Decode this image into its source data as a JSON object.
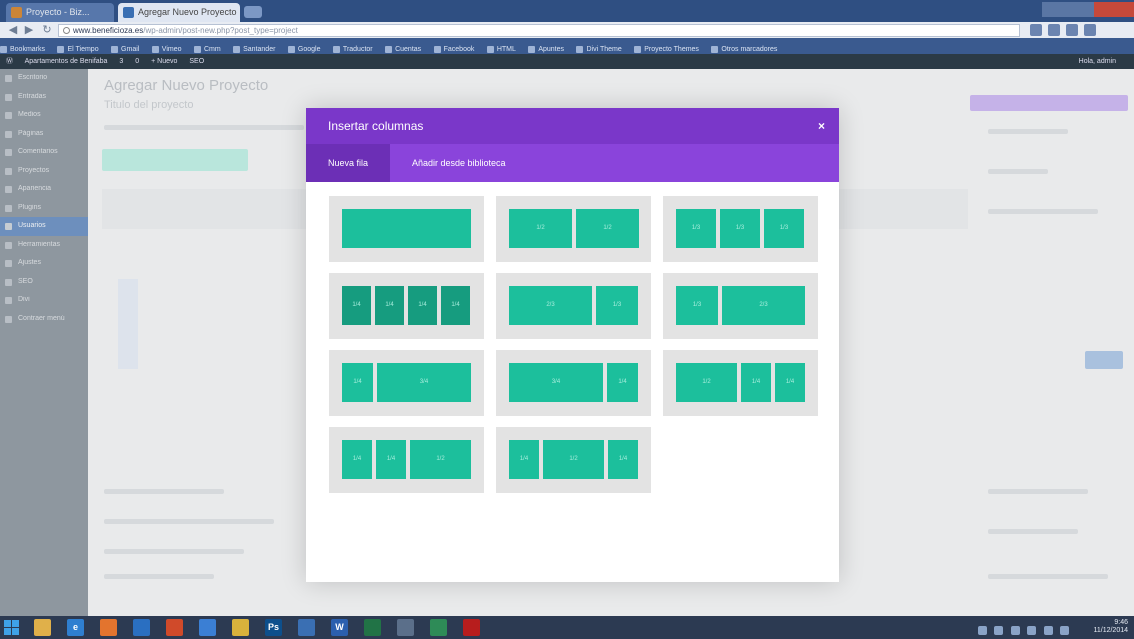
{
  "browser": {
    "tabs": [
      {
        "label": "Proyecto - Biz..."
      },
      {
        "label": "Agregar Nuevo Proyecto"
      }
    ],
    "url_host": "www.beneficioza.es",
    "url_path": "/wp-admin/post-new.php?post_type=project",
    "bookmarks": [
      "Bookmarks",
      "El Tiempo",
      "Gmail",
      "Vimeo",
      "Cmm",
      "Santander",
      "Google",
      "Traductor",
      "Cuentas",
      "Facebook",
      "HTML",
      "Apuntes",
      "Divi Theme",
      "Proyecto Themes",
      "Otros marcadores"
    ],
    "wp_bar": {
      "site": "Apartamentos de Benifaba",
      "comments": "3",
      "updates": "0",
      "new": "+ Nuevo",
      "seo": "SEO",
      "right": "Hola, admin"
    }
  },
  "wp": {
    "page_heading": "Agregar Nuevo Proyecto",
    "post_title": "Titulo del proyecto",
    "menu_items": [
      "Escritorio",
      "Entradas",
      "Medios",
      "Páginas",
      "Comentarios",
      "Proyectos",
      "Apariencia",
      "Plugins",
      "Usuarios",
      "Herramientas",
      "Ajustes",
      "SEO",
      "Divi",
      "Contraer menú"
    ],
    "active_menu_index": 5
  },
  "modal": {
    "title": "Insertar columnas",
    "close_icon": "×",
    "tabs": [
      {
        "label": "Nueva fila",
        "active": true
      },
      {
        "label": "Añadir desde biblioteca",
        "active": false
      }
    ],
    "layouts": [
      {
        "name": "1 columna",
        "columns": [
          ""
        ]
      },
      {
        "name": "1/2 + 1/2",
        "columns": [
          "1/2",
          "1/2"
        ]
      },
      {
        "name": "1/3 + 1/3 + 1/3",
        "columns": [
          "1/3",
          "1/3",
          "1/3"
        ]
      },
      {
        "name": "1/4 x4",
        "columns": [
          "1/4",
          "1/4",
          "1/4",
          "1/4"
        ]
      },
      {
        "name": "2/3 + 1/3",
        "columns": [
          "2/3",
          "1/3"
        ]
      },
      {
        "name": "1/3 + 2/3",
        "columns": [
          "1/3",
          "2/3"
        ]
      },
      {
        "name": "1/4 + 3/4",
        "columns": [
          "1/4",
          "3/4"
        ]
      },
      {
        "name": "3/4 + 1/4",
        "columns": [
          "3/4",
          "1/4"
        ]
      },
      {
        "name": "1/2 + 1/4 + 1/4",
        "columns": [
          "1/2",
          "1/4",
          "1/4"
        ]
      },
      {
        "name": "1/4 + 1/4 + 1/2",
        "columns": [
          "1/4",
          "1/4",
          "1/2"
        ]
      },
      {
        "name": "1/4 + 1/2 + 1/4",
        "columns": [
          "1/4",
          "1/2",
          "1/4"
        ]
      }
    ]
  },
  "taskbar": {
    "apps": [
      {
        "icon": "file-explorer-icon",
        "color": "#e0b04a",
        "glyph": ""
      },
      {
        "icon": "internet-explorer-icon",
        "color": "#2f7fd0",
        "glyph": "e"
      },
      {
        "icon": "firefox-icon",
        "color": "#e3742e",
        "glyph": ""
      },
      {
        "icon": "outlook-icon",
        "color": "#2a6fc1",
        "glyph": ""
      },
      {
        "icon": "powerpoint-icon",
        "color": "#d04a2a",
        "glyph": ""
      },
      {
        "icon": "mail-icon",
        "color": "#3b7fd4",
        "glyph": ""
      },
      {
        "icon": "chrome-icon",
        "color": "#d8b23c",
        "glyph": ""
      },
      {
        "icon": "photoshop-icon",
        "color": "#0d4f8c",
        "glyph": "Ps"
      },
      {
        "icon": "explorer-icon",
        "color": "#3a6fb3",
        "glyph": ""
      },
      {
        "icon": "word-icon",
        "color": "#2b5fae",
        "glyph": "W"
      },
      {
        "icon": "excel-icon",
        "color": "#217346",
        "glyph": ""
      },
      {
        "icon": "calculator-icon",
        "color": "#5b6f8a",
        "glyph": ""
      },
      {
        "icon": "photos-icon",
        "color": "#2e8b57",
        "glyph": ""
      },
      {
        "icon": "acrobat-icon",
        "color": "#b71d1d",
        "glyph": ""
      }
    ],
    "clock_time": "9:46",
    "clock_date": "11/12/2014"
  },
  "colors": {
    "modal_header": "#7a37c9",
    "modal_tabs": "#8a44db",
    "active_tab": "#6c2fb6",
    "column_green": "#1cbf9c",
    "tile_bg": "#e3e3e3"
  }
}
